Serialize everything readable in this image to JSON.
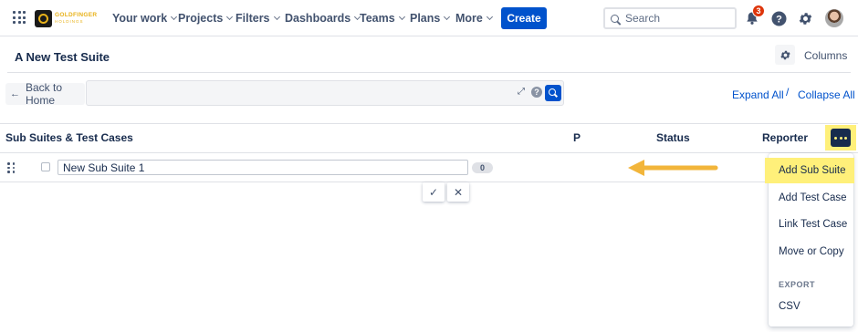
{
  "brand": {
    "logo_line1": "GOLDFINGER",
    "logo_line2": "HOLDINGS"
  },
  "nav": {
    "items": [
      {
        "label": "Your work"
      },
      {
        "label": "Projects"
      },
      {
        "label": "Filters"
      },
      {
        "label": "Dashboards"
      },
      {
        "label": "Teams"
      },
      {
        "label": "Plans"
      },
      {
        "label": "More"
      }
    ],
    "create_label": "Create",
    "search_placeholder": "Search",
    "notifications_count": "3",
    "icons": [
      "app-switcher-icon",
      "bell-icon",
      "help-icon",
      "gear-icon",
      "avatar"
    ]
  },
  "page": {
    "title": "A New Test Suite",
    "columns_label": "Columns"
  },
  "toolbar": {
    "back_label": "Back to Home",
    "filter_value": "",
    "expand_all": "Expand All",
    "separator": "/",
    "collapse_all": "Collapse All",
    "help_glyph": "?"
  },
  "table": {
    "headers": [
      "Sub Suites & Test Cases",
      "P",
      "Status",
      "Reporter"
    ],
    "row": {
      "name_value": "New Sub Suite 1",
      "count": "0"
    },
    "confirm_glyph": "✓",
    "cancel_glyph": "✕"
  },
  "menu": {
    "items": [
      {
        "label": "Add Sub Suite",
        "highlighted": true
      },
      {
        "label": "Add Test Case"
      },
      {
        "label": "Link Test Case"
      },
      {
        "label": "Move or Copy"
      }
    ],
    "section_label": "EXPORT",
    "export_items": [
      {
        "label": "CSV"
      }
    ]
  },
  "colors": {
    "primary": "#0052cc",
    "highlight": "#fff07a",
    "annotation_arrow": "#f2b53a",
    "badge": "#de350b"
  }
}
